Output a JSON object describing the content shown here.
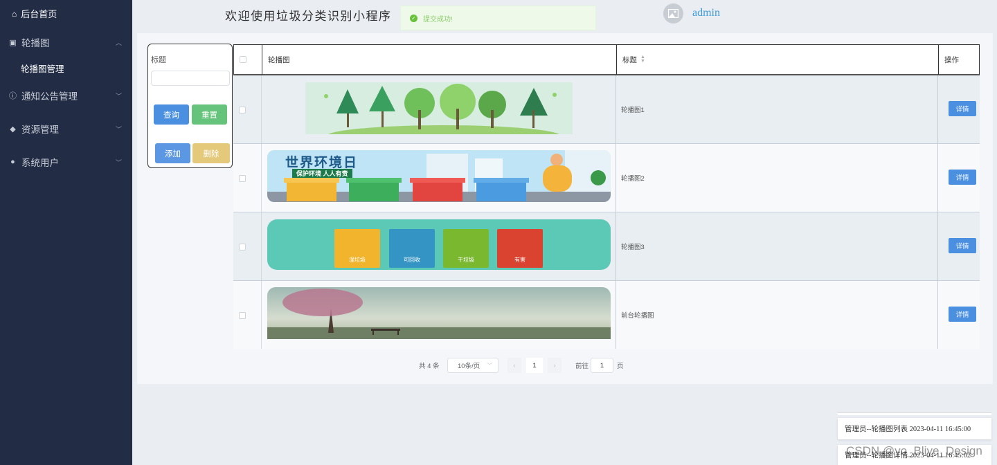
{
  "sidebar": {
    "home": "后台首页",
    "menus": [
      {
        "label": "轮播图",
        "icon": "image-icon"
      },
      {
        "label": "通知公告管理",
        "icon": "info-icon"
      },
      {
        "label": "资源管理",
        "icon": "tag-icon"
      },
      {
        "label": "系统用户",
        "icon": "user-icon"
      }
    ],
    "submenu": "轮播图管理"
  },
  "header": {
    "welcome": "欢迎使用垃圾分类识别小程序",
    "toast": "提交成功!",
    "username": "admin"
  },
  "search": {
    "label": "标题",
    "query_btn": "查询",
    "reset_btn": "重置",
    "add_btn": "添加",
    "delete_btn": "删除"
  },
  "table": {
    "columns": [
      "轮播图",
      "标题",
      "操作"
    ],
    "rows": [
      {
        "title": "轮播图1",
        "action": "详情"
      },
      {
        "title": "轮播图2",
        "action": "详情"
      },
      {
        "title": "轮播图3",
        "action": "详情"
      },
      {
        "title": "前台轮播图",
        "action": "详情"
      }
    ],
    "banner2_text": "世界环境日",
    "banner2_sub": "保护环境 人人有责",
    "bins": [
      "湿垃圾",
      "可回收",
      "干垃圾",
      "有害"
    ]
  },
  "pagination": {
    "total": "共 4 条",
    "page_size": "10条/页",
    "current": "1",
    "goto_label": "前往",
    "goto_value": "1",
    "page_unit": "页"
  },
  "logs": [
    "管理员--轮播图列表 2023-04-11 16:45:00",
    "管理员--轮播图详情 2023-04-11 16:45:02"
  ],
  "watermark": "CSDN @yo_Bliye_Design",
  "colors": {
    "sidebar": "#222c45",
    "primary": "#4a8fe0",
    "success": "#67c23a",
    "warning": "#e4c97a"
  }
}
